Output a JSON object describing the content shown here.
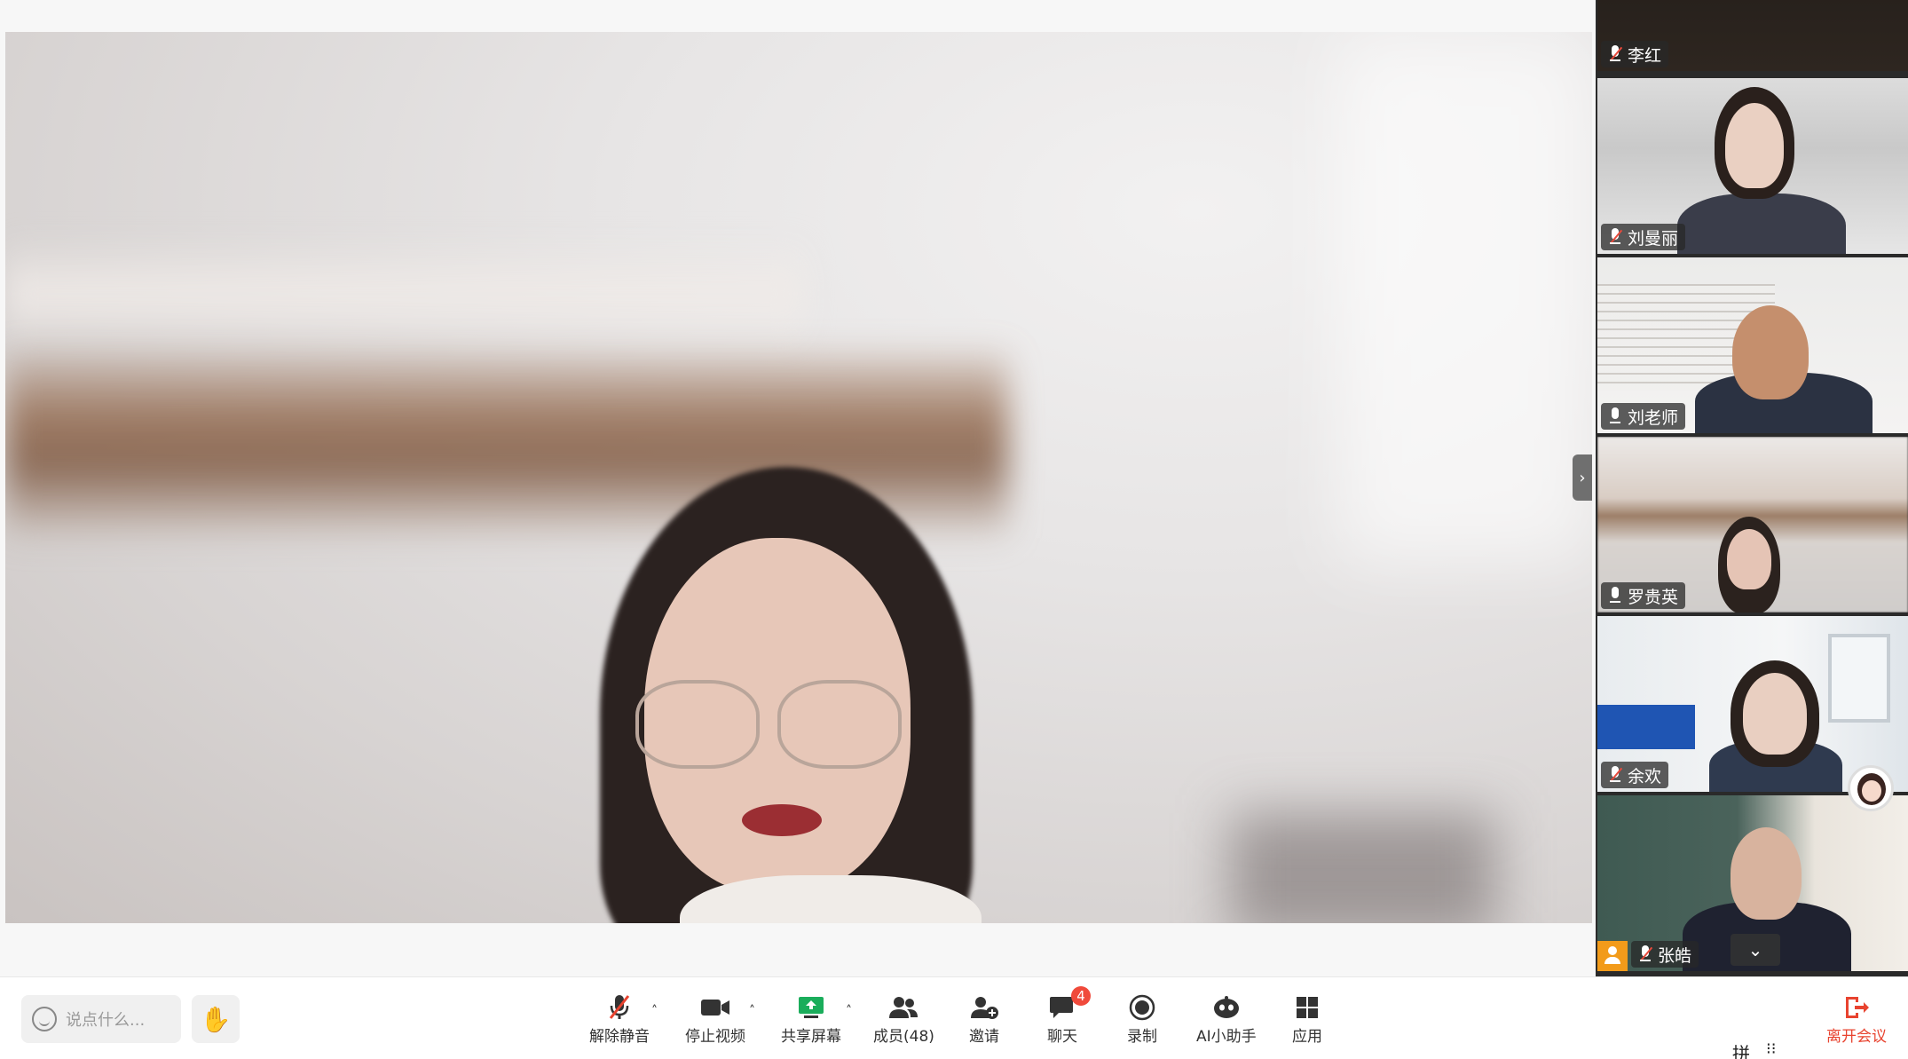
{
  "stage": {
    "collapse_icon": "chevron-right-icon",
    "collapse_glyph": "›"
  },
  "participants": [
    {
      "name": "李红",
      "mic": "muted"
    },
    {
      "name": "刘曼丽",
      "mic": "muted"
    },
    {
      "name": "刘老师",
      "mic": "on"
    },
    {
      "name": "罗贵英",
      "mic": "on"
    },
    {
      "name": "余欢",
      "mic": "muted"
    },
    {
      "name": "张皓",
      "mic": "muted",
      "host": true
    }
  ],
  "rail": {
    "scroll_glyph": "⌄"
  },
  "toolbar": {
    "chat_placeholder": "说点什么...",
    "raise_hand_glyph": "✋",
    "unmute": "解除静音",
    "stop_video": "停止视频",
    "share_screen": "共享屏幕",
    "members": "成员(48)",
    "invite": "邀请",
    "chat": "聊天",
    "chat_badge": "4",
    "record": "录制",
    "ai_assistant": "AI小助手",
    "apps": "应用",
    "leave": "离开会议",
    "ime": "拼",
    "caret": "˄"
  },
  "colors": {
    "accent_red": "#e8432f",
    "badge_red": "#f04a3b",
    "share_green": "#1aad5b",
    "host_orange": "#f29b1a"
  }
}
